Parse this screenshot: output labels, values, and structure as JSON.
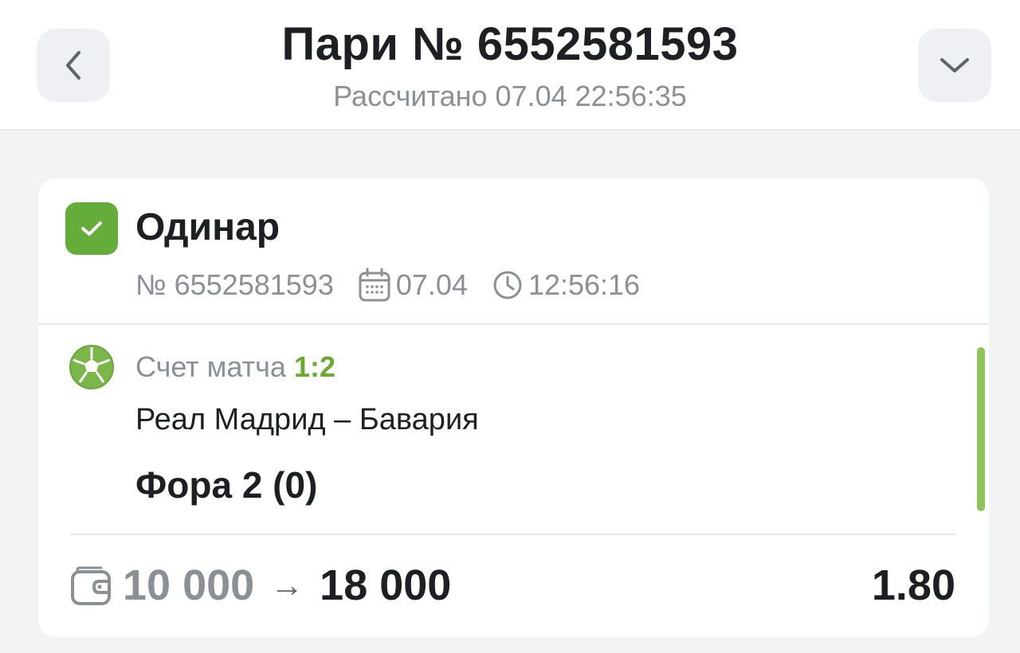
{
  "header": {
    "title": "Пари № 6552581593",
    "subtitle": "Рассчитано 07.04 22:56:35",
    "back_icon": "chevron-left-icon",
    "expand_icon": "chevron-down-icon"
  },
  "bet": {
    "type": "Одинар",
    "status_icon": "check-icon",
    "status_color": "#65ad3a",
    "number": "№ 6552581593",
    "date": "07.04",
    "time": "12:56:16"
  },
  "event": {
    "sport_icon": "soccer-ball-icon",
    "score_label": "Счет матча",
    "score": "1:2",
    "teams": "Реал Мадрид – Бавария",
    "outcome": "Фора 2 (0)"
  },
  "totals": {
    "stake": "10 000",
    "arrow": "→",
    "payout": "18 000",
    "coefficient": "1.80"
  },
  "colors": {
    "win_green": "#6aaa2e",
    "accent_bar": "#8fc45a",
    "muted_text": "#8b9097"
  }
}
